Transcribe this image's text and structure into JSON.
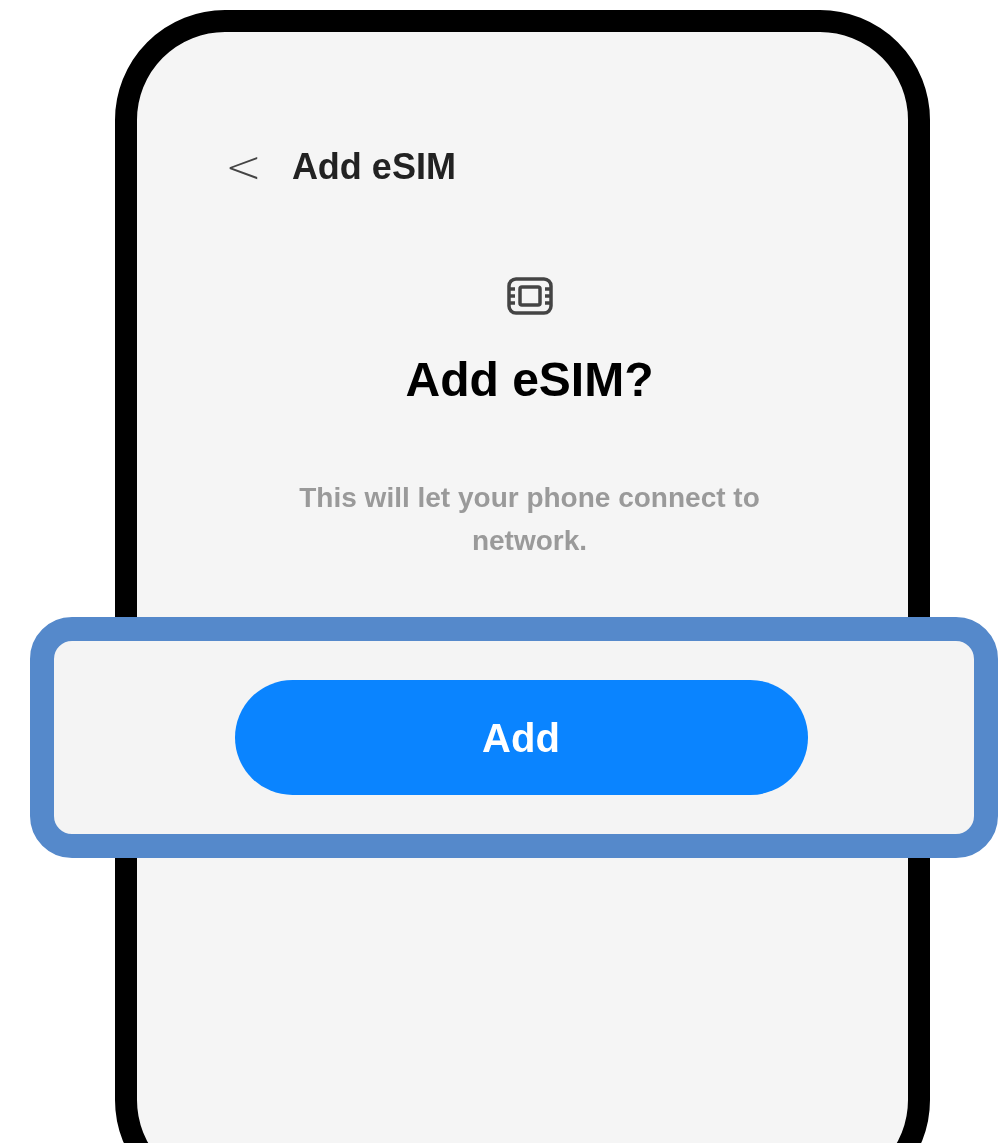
{
  "header": {
    "back_glyph": "<",
    "title": "Add eSIM"
  },
  "dialog": {
    "title": "Add eSIM?",
    "message": "This will let your phone connect to network."
  },
  "primary_button": {
    "label": "Add",
    "highlighted": true
  }
}
